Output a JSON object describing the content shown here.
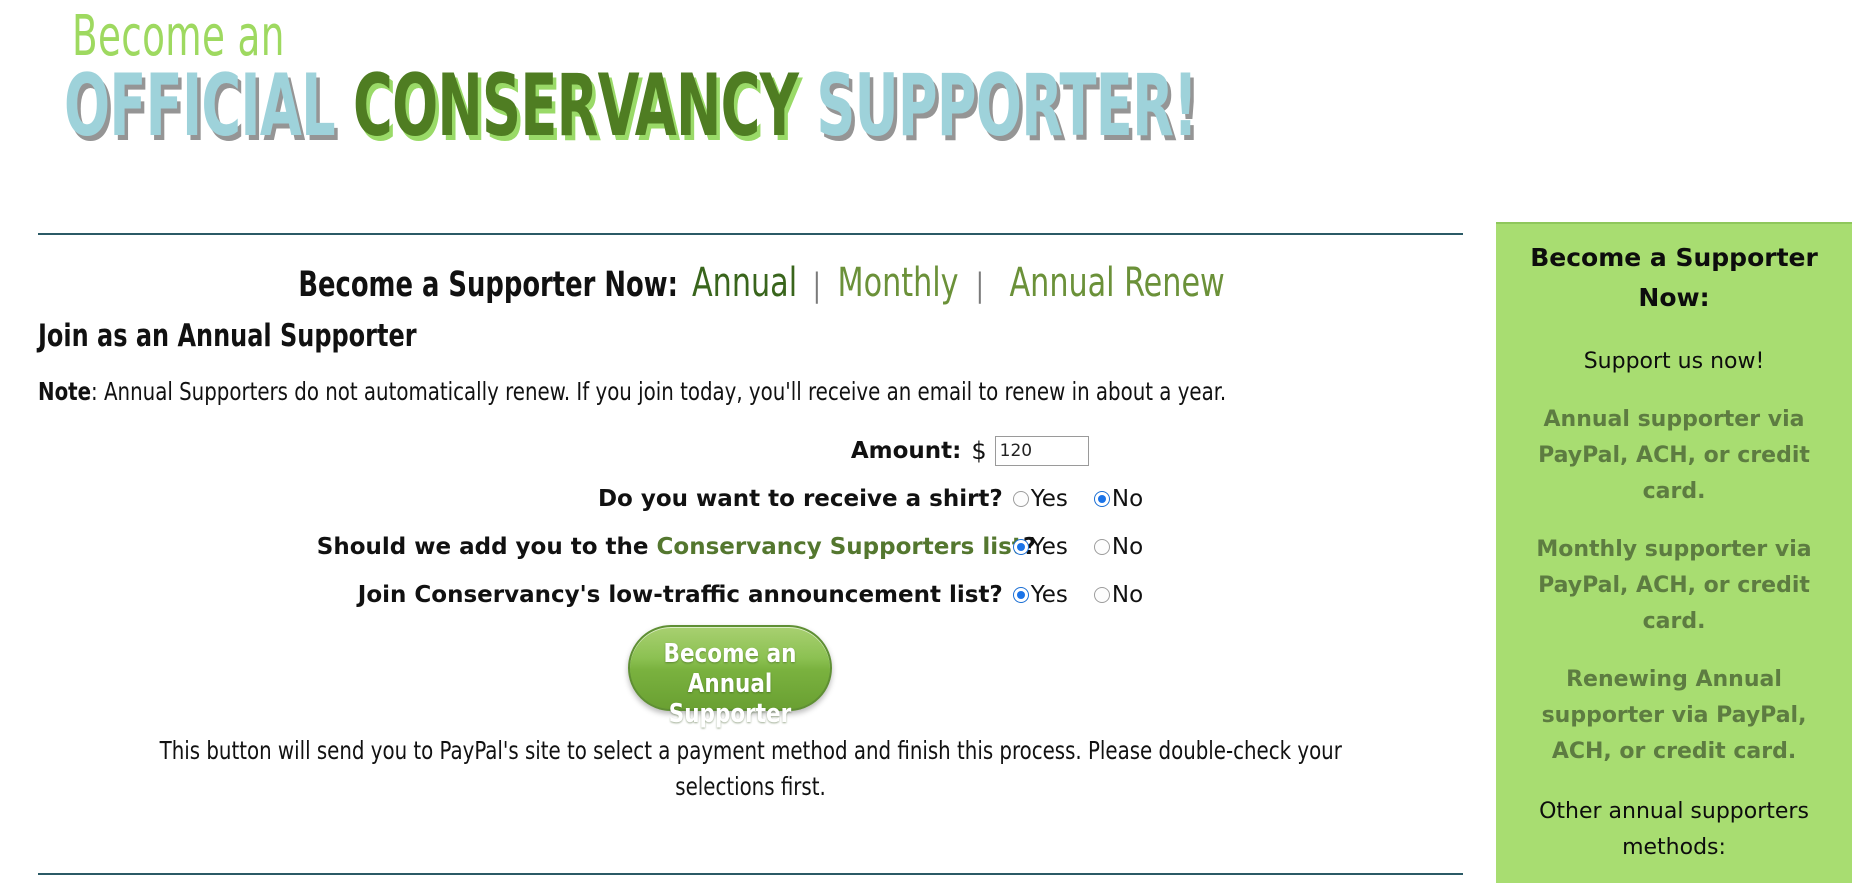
{
  "banner": {
    "line1": "Become an",
    "word_official": "OFFICIAL",
    "word_conservancy": "CONSERVANCY",
    "word_supporter": "SUPPORTER!",
    "colors": {
      "light_green": "#9ed960",
      "pale_blue": "#9ed2da",
      "dark_green": "#4f7d22",
      "shadow_green": "#9ada68",
      "shadow_gray": "#828282"
    }
  },
  "nav": {
    "lead": "Become a Supporter Now:",
    "annual": "Annual",
    "sep": "|",
    "monthly": "Monthly",
    "annual_renew": "Annual Renew"
  },
  "main": {
    "section_title": "Join as an Annual Supporter",
    "note_label": "Note",
    "note_text": ": Annual Supporters do not automatically renew. If you join today, you'll receive an email to renew in about a year.",
    "finish_note_line1": "This button will send you to PayPal's site to select a payment method and finish this process. Please double-check your",
    "finish_note_line2": "selections first."
  },
  "form": {
    "amount_label": "Amount:",
    "currency_symbol": "$",
    "amount_value": "120",
    "amount_placeholder": "",
    "rows": [
      {
        "label": "Do you want to receive a shirt?",
        "link_text": "",
        "label_suffix": "",
        "options": [
          {
            "label": "Yes",
            "checked": false
          },
          {
            "label": "No",
            "checked": true
          }
        ]
      },
      {
        "label": "Should we add you to the ",
        "link_text": "Conservancy Supporters list",
        "label_suffix": "?",
        "options": [
          {
            "label": "Yes",
            "checked": true
          },
          {
            "label": "No",
            "checked": false
          }
        ]
      },
      {
        "label": "Join Conservancy's low-traffic announcement list?",
        "link_text": "",
        "label_suffix": "",
        "options": [
          {
            "label": "Yes",
            "checked": true
          },
          {
            "label": "No",
            "checked": false
          }
        ]
      }
    ],
    "submit_line1": "Become an",
    "submit_line2": "Annual Supporter"
  },
  "sidebar": {
    "heading": "Become a Supporter Now:",
    "intro": "Support us now!",
    "links": [
      "Annual supporter via PayPal, ACH, or credit card.",
      "Monthly supporter via PayPal, ACH, or credit card.",
      "Renewing Annual supporter via PayPal, ACH, or credit card."
    ],
    "other_methods": "Other annual supporters methods:",
    "bg_color": "#a8dd71",
    "link_color": "#5d7c41"
  }
}
